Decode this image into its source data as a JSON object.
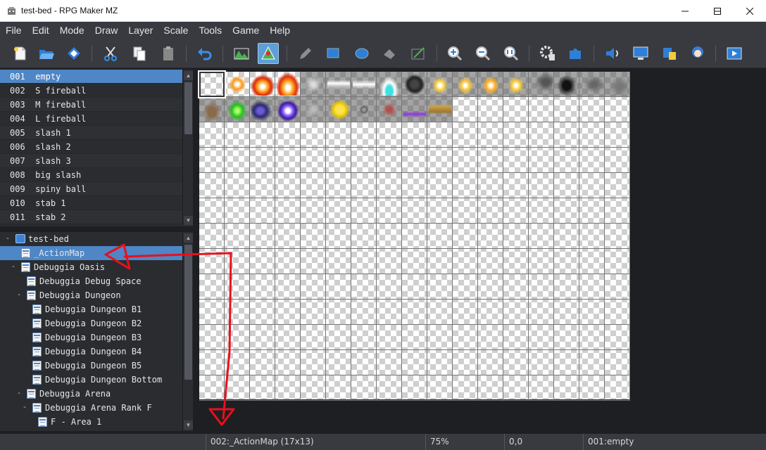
{
  "window": {
    "title": "test-bed - RPG Maker MZ"
  },
  "menubar": {
    "items": [
      "File",
      "Edit",
      "Mode",
      "Draw",
      "Layer",
      "Scale",
      "Tools",
      "Game",
      "Help"
    ]
  },
  "toolbar": {
    "icons": [
      "new-project-icon",
      "open-project-icon",
      "save-project-icon",
      "cut-icon",
      "copy-icon",
      "paste-icon",
      "undo-icon",
      "map-mode-icon",
      "event-mode-icon",
      "pencil-icon",
      "rectangle-icon",
      "ellipse-icon",
      "fill-icon",
      "shadow-pen-icon",
      "zoom-in-icon",
      "zoom-out-icon",
      "actual-size-icon",
      "database-icon",
      "plugin-manager-icon",
      "sound-test-icon",
      "event-searcher-icon",
      "resource-manager-icon",
      "character-generator-icon",
      "playtest-icon"
    ],
    "active": "event-mode-icon"
  },
  "animation_list": {
    "items": [
      {
        "id": "001",
        "name": "empty"
      },
      {
        "id": "002",
        "name": "S fireball"
      },
      {
        "id": "003",
        "name": "M fireball"
      },
      {
        "id": "004",
        "name": "L fireball"
      },
      {
        "id": "005",
        "name": "slash 1"
      },
      {
        "id": "006",
        "name": "slash 2"
      },
      {
        "id": "007",
        "name": "slash 3"
      },
      {
        "id": "008",
        "name": "big slash"
      },
      {
        "id": "009",
        "name": "spiny ball"
      },
      {
        "id": "010",
        "name": "stab 1"
      },
      {
        "id": "011",
        "name": "stab 2"
      }
    ],
    "selected_index": 0
  },
  "map_tree": {
    "items": [
      {
        "label": "test-bed",
        "depth": 0,
        "type": "project",
        "toggle": "-"
      },
      {
        "label": "_ActionMap",
        "depth": 1,
        "type": "map",
        "toggle": "",
        "selected": true
      },
      {
        "label": "Debuggia Oasis",
        "depth": 1,
        "type": "map",
        "toggle": "-"
      },
      {
        "label": "Debuggia Debug Space",
        "depth": 2,
        "type": "map",
        "toggle": ""
      },
      {
        "label": "Debuggia Dungeon",
        "depth": 2,
        "type": "map",
        "toggle": "-"
      },
      {
        "label": "Debuggia Dungeon B1",
        "depth": 3,
        "type": "map",
        "toggle": ""
      },
      {
        "label": "Debuggia Dungeon B2",
        "depth": 3,
        "type": "map",
        "toggle": ""
      },
      {
        "label": "Debuggia Dungeon B3",
        "depth": 3,
        "type": "map",
        "toggle": ""
      },
      {
        "label": "Debuggia Dungeon B4",
        "depth": 3,
        "type": "map",
        "toggle": ""
      },
      {
        "label": "Debuggia Dungeon B5",
        "depth": 3,
        "type": "map",
        "toggle": ""
      },
      {
        "label": "Debuggia Dungeon Bottom",
        "depth": 3,
        "type": "map",
        "toggle": ""
      },
      {
        "label": "Debuggia Arena",
        "depth": 2,
        "type": "map",
        "toggle": "-"
      },
      {
        "label": "Debuggia Arena Rank F",
        "depth": 3,
        "type": "map",
        "toggle": "-"
      },
      {
        "label": "F - Area 1",
        "depth": 4,
        "type": "map",
        "toggle": ""
      }
    ]
  },
  "statusbar": {
    "map": "002:_ActionMap (17x13)",
    "zoom": "75%",
    "coords": "0,0",
    "selection": "001:empty"
  },
  "colors": {
    "selection": "#4f86c6",
    "annotation": "#e8101c"
  }
}
